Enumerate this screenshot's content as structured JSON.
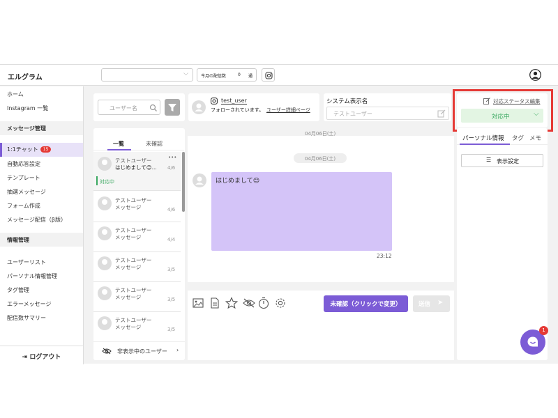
{
  "header": {
    "brand": "エルグラム",
    "count_label": "今月の配信数",
    "count_value": "0",
    "count_unit": "通"
  },
  "sidebar": {
    "home": "ホーム",
    "instagram": "Instagram 一覧",
    "section_message": "メッセージ管理",
    "chat": "1:1チャット",
    "chat_badge": "15",
    "auto_reply": "自動応答設定",
    "template": "テンプレート",
    "lottery": "抽選メッセージ",
    "form": "フォーム作成",
    "broadcast": "メッセージ配信（β版）",
    "section_info": "情報管理",
    "user_list": "ユーザーリスト",
    "personal_info": "パーソナル情報管理",
    "tag_manage": "タグ管理",
    "error_msg": "エラーメッセージ",
    "summary": "配信数サマリー",
    "logout": "ログアウト"
  },
  "list_panel": {
    "search_placeholder": "ユーザー名",
    "tab_all": "一覧",
    "tab_unread": "未確認",
    "hidden_users": "非表示中のユーザー",
    "conversations": [
      {
        "name": "テストユーザー",
        "preview": "はじめまして😊...",
        "date": "4/6",
        "status": "対応中",
        "more": "•••"
      },
      {
        "name": "テストユーザー",
        "preview": "メッセージ",
        "date": "4/6"
      },
      {
        "name": "テストユーザー",
        "preview": "メッセージ",
        "date": "4/4"
      },
      {
        "name": "テストユーザー",
        "preview": "メッセージ",
        "date": "3/5"
      },
      {
        "name": "テストユーザー",
        "preview": "メッセージ",
        "date": "3/5"
      },
      {
        "name": "テストユーザー",
        "preview": "メッセージ",
        "date": "3/5"
      }
    ]
  },
  "user_header": {
    "username": "test_user",
    "follow_status": "フォローされています。",
    "detail_link": "ユーザー詳細ページ",
    "system_name_label": "システム表示名",
    "system_name_placeholder": "テストユーザー"
  },
  "chat": {
    "date_top": "04月06日(土)",
    "date_mid": "04月06日(土)",
    "message_text": "はじめまして😊",
    "message_time": "23:12",
    "unread_button": "未確認（クリックで変更）",
    "send_button": "送信"
  },
  "right_panel": {
    "status_edit_link": "対応ステータス編集",
    "status_value": "対応中",
    "tab_personal": "パーソナル情報",
    "tab_tag": "タグ",
    "tab_memo": "メモ",
    "display_settings": "表示設定"
  },
  "colors": {
    "accent": "#7c5cd6",
    "bubble": "#d4c4f8",
    "status_bg": "#e3f5e3",
    "status_text": "#3aa860",
    "highlight_box": "#e53935",
    "badge": "#e53935"
  }
}
